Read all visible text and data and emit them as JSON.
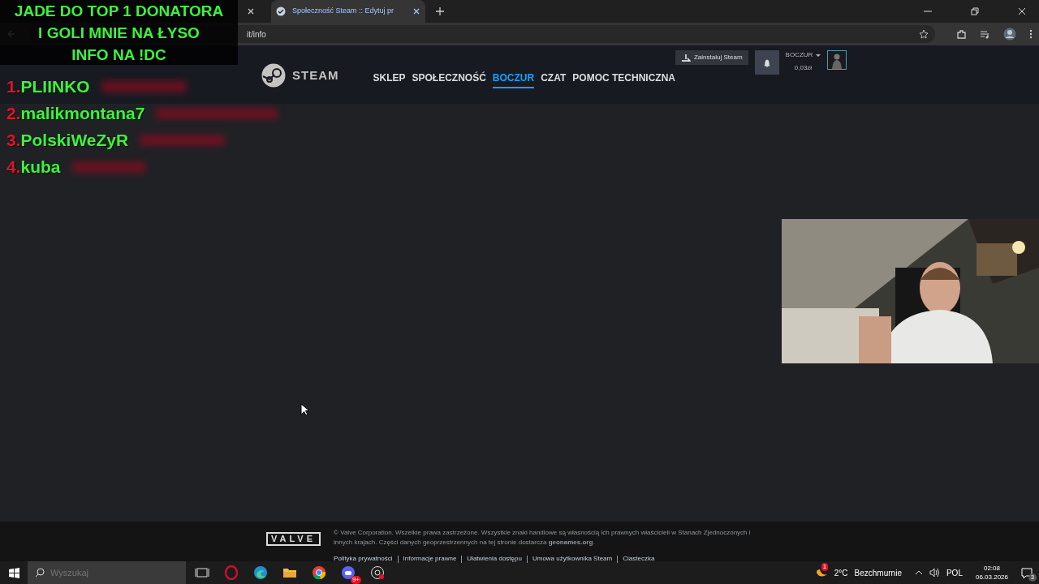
{
  "stream_overlay": {
    "headline": [
      "JADE DO TOP 1 DONATORA",
      "I GOLI MNIE NA ŁYSO",
      "INFO NA !DC"
    ],
    "donors": [
      {
        "rank": "1.",
        "name": "PLIINKO"
      },
      {
        "rank": "2.",
        "name": "malikmontana7"
      },
      {
        "rank": "3.",
        "name": "PolskiWeZyR"
      },
      {
        "rank": "4.",
        "name": "kuba"
      }
    ],
    "webcam": {
      "kind": "picture"
    }
  },
  "browser": {
    "tabs": [
      {
        "title": "Społeczność Steam :: Edytuj pr",
        "selected": true
      }
    ],
    "url": "it/info"
  },
  "steam_header": {
    "logo": "STEAM",
    "nav": [
      {
        "label": "SKLEP",
        "selected": false
      },
      {
        "label": "SPOŁECZNOŚĆ",
        "selected": false
      },
      {
        "label": "BOCZUR",
        "selected": true
      },
      {
        "label": "CZAT",
        "selected": false
      },
      {
        "label": "POMOC TECHNICZNA",
        "selected": false
      }
    ],
    "install_button": "Zainstaluj Steam",
    "account": "BOCZUR",
    "balance": "0,03zł"
  },
  "footer": {
    "logo": "VALVE",
    "copyright": "© Valve Corporation. Wszelkie prawa zastrzeżone. Wszystkie znaki handlowe są własnością ich prawnych właścicieli w Stanach Zjednoczonych i innych krajach. Części danych geoprzestrzennych na tej stronie dostarcza **geonames.org**.",
    "links": [
      "Polityka prywatności",
      "Informacje prawne",
      "Ułatwienia dostępu",
      "Umowa użytkownika Steam",
      "Ciasteczka"
    ]
  },
  "taskbar": {
    "search_placeholder": "Wyszukaj",
    "discord_badge": "9+",
    "weather_badge": "1",
    "temperature": "2°C",
    "weather": "Bezchmurnie",
    "language": "POL",
    "time": "02:08",
    "date": "06.03.2026",
    "notifications": "3"
  }
}
